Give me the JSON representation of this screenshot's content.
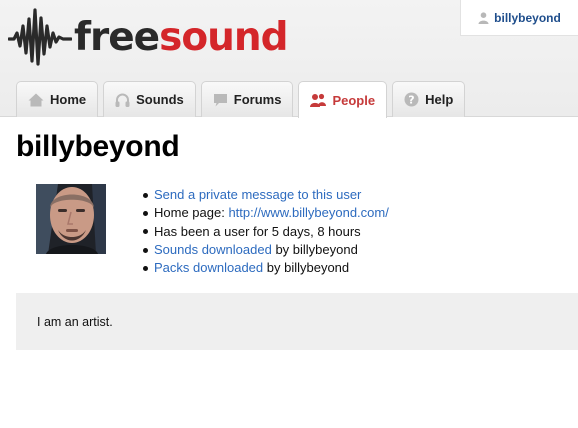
{
  "brand": {
    "logo_free": "free",
    "logo_sound": "sound",
    "colors": {
      "dark": "#2a2a2a",
      "red": "#d4262a",
      "link": "#2d6bbf",
      "active_tab": "#c63a3a"
    }
  },
  "user_menu": {
    "username": "billybeyond",
    "icon": "user-icon"
  },
  "nav": {
    "tabs": [
      {
        "label": "Home",
        "icon": "home-icon",
        "active": false
      },
      {
        "label": "Sounds",
        "icon": "headphones-icon",
        "active": false
      },
      {
        "label": "Forums",
        "icon": "speech-bubble-icon",
        "active": false
      },
      {
        "label": "People",
        "icon": "people-icon",
        "active": true
      },
      {
        "label": "Help",
        "icon": "question-icon",
        "active": false
      }
    ]
  },
  "profile": {
    "title": "billybeyond",
    "send_message": "Send a private message to this user",
    "home_page_label": "Home page: ",
    "home_page_url": "http://www.billybeyond.com/",
    "member_since": "Has been a user for 5 days, 8 hours",
    "sounds_downloaded_link": "Sounds downloaded",
    "packs_downloaded_link": "Packs downloaded",
    "by_user": " by billybeyond",
    "bio": "I am an artist."
  }
}
